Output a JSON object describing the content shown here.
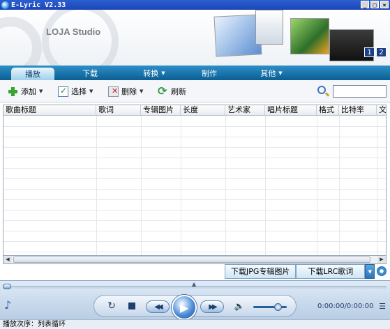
{
  "window": {
    "title": "E-Lyric V2.33",
    "min_glyph": "_",
    "max_glyph": "□",
    "close_glyph": "×"
  },
  "banner": {
    "brand": "LOJA Studio",
    "pages": [
      "1",
      "2"
    ]
  },
  "nav": {
    "tabs": [
      {
        "label": "播放",
        "active": true
      },
      {
        "label": "下载",
        "active": false
      },
      {
        "label": "转换",
        "active": false,
        "dropdown": true
      },
      {
        "label": "制作",
        "active": false
      },
      {
        "label": "其他",
        "active": false,
        "dropdown": true
      }
    ]
  },
  "toolbar": {
    "add": "添加",
    "select": "选择",
    "delete": "删除",
    "refresh": "刷新",
    "search_value": ""
  },
  "table": {
    "columns": [
      "歌曲标题",
      "歌词",
      "专辑图片",
      "长度",
      "艺术家",
      "唱片标题",
      "格式",
      "比特率",
      "文"
    ],
    "rows": []
  },
  "download": {
    "jpg": "下载JPG专辑图片",
    "lrc": "下载LRC歌词"
  },
  "player": {
    "progress": 0,
    "volume": 0.72,
    "time": "0:00:00/0:00:00"
  },
  "status": {
    "text": "播放次序：列表循环"
  },
  "icons": {
    "app": "app-icon",
    "add": "plus-icon",
    "select": "checkbox-icon",
    "delete": "delete-icon",
    "refresh": "refresh-icon",
    "search": "search-icon",
    "music": "music-note-icon",
    "repeat": "repeat-icon",
    "stop": "stop-icon",
    "prev": "previous-icon",
    "play": "play-icon",
    "next": "next-icon",
    "volume": "volume-icon",
    "playlist": "playlist-icon"
  },
  "colors": {
    "titlebar": "#1c46b6",
    "nav": "#0b5e93",
    "player": "#b9cde4"
  }
}
